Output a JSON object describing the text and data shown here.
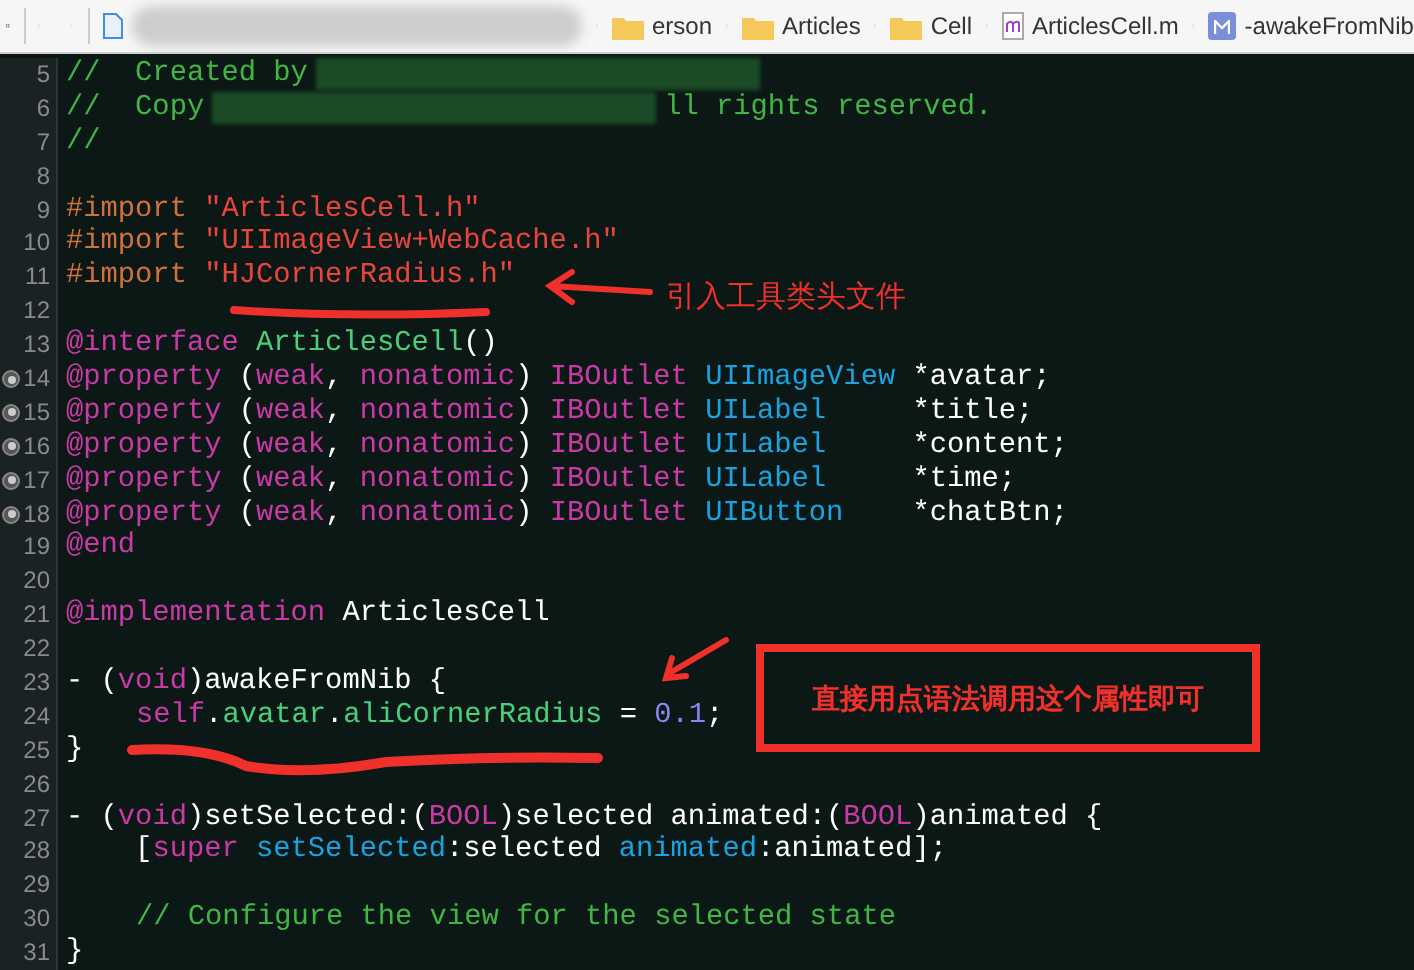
{
  "breadcrumb": [
    {
      "kind": "redacted"
    },
    {
      "kind": "folder",
      "label": "erson"
    },
    {
      "kind": "folder",
      "label": "Articles"
    },
    {
      "kind": "folder",
      "label": "Cell"
    },
    {
      "kind": "source",
      "label": "ArticlesCell.m"
    },
    {
      "kind": "method",
      "label": "-awakeFromNib"
    }
  ],
  "lines": [
    {
      "n": "5",
      "outlet": false,
      "tokens": [
        {
          "color": "#41b645",
          "t": "//  Created by"
        },
        {
          "kind": "redacted"
        }
      ]
    },
    {
      "n": "6",
      "outlet": false,
      "tokens": [
        {
          "color": "#41b645",
          "t": "//  Copy"
        },
        {
          "kind": "redacted"
        },
        {
          "color": "#41b645",
          "t": "ll rights reserved."
        }
      ]
    },
    {
      "n": "7",
      "outlet": false,
      "tokens": [
        {
          "color": "#41b645",
          "t": "//"
        }
      ]
    },
    {
      "n": "8",
      "outlet": false
    },
    {
      "n": "9",
      "outlet": false,
      "tokens": [
        {
          "color": "#d0713a",
          "t": "#import "
        },
        {
          "color": "#e8453c",
          "t": "\"ArticlesCell.h\""
        }
      ]
    },
    {
      "n": "10",
      "outlet": false,
      "tokens": [
        {
          "color": "#d0713a",
          "t": "#import "
        },
        {
          "color": "#e8453c",
          "t": "\"UIImageView+WebCache.h\""
        }
      ]
    },
    {
      "n": "11",
      "outlet": false,
      "tokens": [
        {
          "color": "#d0713a",
          "t": "#import "
        },
        {
          "color": "#e8453c",
          "t": "\"HJCornerRadius.h\""
        }
      ]
    },
    {
      "n": "12",
      "outlet": false
    },
    {
      "n": "13",
      "outlet": false,
      "tokens": [
        {
          "color": "#c93aa6",
          "t": "@interface "
        },
        {
          "color": "#4ad07b",
          "t": "ArticlesCell"
        },
        {
          "color": "#ffffff",
          "t": "()"
        }
      ]
    },
    {
      "n": "14",
      "outlet": true,
      "tokens": [
        {
          "color": "#c93aa6",
          "t": "@property"
        },
        {
          "color": "#ffffff",
          "t": " ("
        },
        {
          "color": "#c93aa6",
          "t": "weak"
        },
        {
          "color": "#ffffff",
          "t": ", "
        },
        {
          "color": "#c93aa6",
          "t": "nonatomic"
        },
        {
          "color": "#ffffff",
          "t": ") "
        },
        {
          "color": "#c93aa6",
          "t": "IBOutlet "
        },
        {
          "color": "#1aa3e0",
          "t": "UIImageView"
        },
        {
          "color": "#ffffff",
          "t": " *avatar;"
        }
      ]
    },
    {
      "n": "15",
      "outlet": true,
      "tokens": [
        {
          "color": "#c93aa6",
          "t": "@property"
        },
        {
          "color": "#ffffff",
          "t": " ("
        },
        {
          "color": "#c93aa6",
          "t": "weak"
        },
        {
          "color": "#ffffff",
          "t": ", "
        },
        {
          "color": "#c93aa6",
          "t": "nonatomic"
        },
        {
          "color": "#ffffff",
          "t": ") "
        },
        {
          "color": "#c93aa6",
          "t": "IBOutlet "
        },
        {
          "color": "#1aa3e0",
          "t": "UILabel"
        },
        {
          "color": "#ffffff",
          "t": "     *title;"
        }
      ]
    },
    {
      "n": "16",
      "outlet": true,
      "tokens": [
        {
          "color": "#c93aa6",
          "t": "@property"
        },
        {
          "color": "#ffffff",
          "t": " ("
        },
        {
          "color": "#c93aa6",
          "t": "weak"
        },
        {
          "color": "#ffffff",
          "t": ", "
        },
        {
          "color": "#c93aa6",
          "t": "nonatomic"
        },
        {
          "color": "#ffffff",
          "t": ") "
        },
        {
          "color": "#c93aa6",
          "t": "IBOutlet "
        },
        {
          "color": "#1aa3e0",
          "t": "UILabel"
        },
        {
          "color": "#ffffff",
          "t": "     *content;"
        }
      ]
    },
    {
      "n": "17",
      "outlet": true,
      "tokens": [
        {
          "color": "#c93aa6",
          "t": "@property"
        },
        {
          "color": "#ffffff",
          "t": " ("
        },
        {
          "color": "#c93aa6",
          "t": "weak"
        },
        {
          "color": "#ffffff",
          "t": ", "
        },
        {
          "color": "#c93aa6",
          "t": "nonatomic"
        },
        {
          "color": "#ffffff",
          "t": ") "
        },
        {
          "color": "#c93aa6",
          "t": "IBOutlet "
        },
        {
          "color": "#1aa3e0",
          "t": "UILabel"
        },
        {
          "color": "#ffffff",
          "t": "     *time;"
        }
      ]
    },
    {
      "n": "18",
      "outlet": true,
      "tokens": [
        {
          "color": "#c93aa6",
          "t": "@property"
        },
        {
          "color": "#ffffff",
          "t": " ("
        },
        {
          "color": "#c93aa6",
          "t": "weak"
        },
        {
          "color": "#ffffff",
          "t": ", "
        },
        {
          "color": "#c93aa6",
          "t": "nonatomic"
        },
        {
          "color": "#ffffff",
          "t": ") "
        },
        {
          "color": "#c93aa6",
          "t": "IBOutlet "
        },
        {
          "color": "#1aa3e0",
          "t": "UIButton"
        },
        {
          "color": "#ffffff",
          "t": "    *chatBtn;"
        }
      ]
    },
    {
      "n": "19",
      "outlet": false,
      "tokens": [
        {
          "color": "#c93aa6",
          "t": "@end"
        }
      ]
    },
    {
      "n": "20",
      "outlet": false
    },
    {
      "n": "21",
      "outlet": false,
      "tokens": [
        {
          "color": "#c93aa6",
          "t": "@implementation "
        },
        {
          "color": "#ffffff",
          "t": "ArticlesCell"
        }
      ]
    },
    {
      "n": "22",
      "outlet": false
    },
    {
      "n": "23",
      "outlet": false,
      "tokens": [
        {
          "color": "#ffffff",
          "t": "- ("
        },
        {
          "color": "#c93aa6",
          "t": "void"
        },
        {
          "color": "#ffffff",
          "t": ")awakeFromNib {"
        }
      ]
    },
    {
      "n": "24",
      "outlet": false,
      "indent": true,
      "tokens": [
        {
          "color": "#c93aa6",
          "t": "self"
        },
        {
          "color": "#ffffff",
          "t": "."
        },
        {
          "color": "#4ad07b",
          "t": "avatar"
        },
        {
          "color": "#ffffff",
          "t": "."
        },
        {
          "color": "#4ad07b",
          "t": "aliCornerRadius"
        },
        {
          "color": "#ffffff",
          "t": " = "
        },
        {
          "color": "#8b87ee",
          "t": "0.1"
        },
        {
          "color": "#ffffff",
          "t": ";"
        }
      ]
    },
    {
      "n": "25",
      "outlet": false,
      "tokens": [
        {
          "color": "#ffffff",
          "t": "}"
        }
      ]
    },
    {
      "n": "26",
      "outlet": false
    },
    {
      "n": "27",
      "outlet": false,
      "tokens": [
        {
          "color": "#ffffff",
          "t": "- ("
        },
        {
          "color": "#c93aa6",
          "t": "void"
        },
        {
          "color": "#ffffff",
          "t": ")setSelected:("
        },
        {
          "color": "#c93aa6",
          "t": "BOOL"
        },
        {
          "color": "#ffffff",
          "t": ")selected animated:("
        },
        {
          "color": "#c93aa6",
          "t": "BOOL"
        },
        {
          "color": "#ffffff",
          "t": ")animated {"
        }
      ]
    },
    {
      "n": "28",
      "outlet": false,
      "tokens": [
        {
          "color": "#ffffff",
          "t": "    ["
        },
        {
          "color": "#c93aa6",
          "t": "super "
        },
        {
          "color": "#1aa3e0",
          "t": "setSelected"
        },
        {
          "color": "#ffffff",
          "t": ":selected "
        },
        {
          "color": "#1aa3e0",
          "t": "animated"
        },
        {
          "color": "#ffffff",
          "t": ":animated];"
        }
      ]
    },
    {
      "n": "29",
      "outlet": false
    },
    {
      "n": "30",
      "outlet": false,
      "indent": true,
      "tokens": [
        {
          "color": "#41b645",
          "t": "// Configure the view for the selected state"
        }
      ]
    },
    {
      "n": "31",
      "outlet": false,
      "tokens": [
        {
          "color": "#ffffff",
          "t": "}"
        }
      ]
    }
  ],
  "annotations": [
    {
      "kind": "arrow",
      "text": "引入工具类头文件"
    },
    {
      "kind": "boxed",
      "text": "直接用点语法调用这个属性即可"
    }
  ]
}
